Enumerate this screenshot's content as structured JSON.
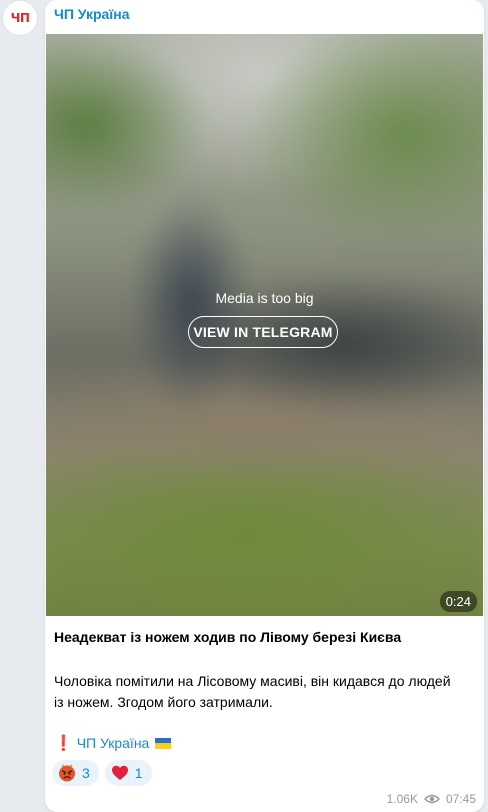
{
  "channel": {
    "name": "ЧП Україна",
    "avatar_text": "ЧП"
  },
  "media": {
    "message": "Media is too big",
    "button_label": "VIEW IN TELEGRAM",
    "duration": "0:24"
  },
  "post": {
    "title": "Неадекват із ножем ходив по Лівому березі Києва",
    "body_line1": "Чоловіка помітили на Лісовому масиві, він кидався до людей",
    "body_line2": "із ножем. Згодом його затримали.",
    "signature_mark": "❗",
    "signature": "ЧП Україна"
  },
  "reactions": [
    {
      "emoji": "angry-face-icon",
      "count": "3"
    },
    {
      "emoji": "red-heart-icon",
      "count": "1"
    }
  ],
  "meta": {
    "views": "1.06K",
    "time": "07:45"
  },
  "colors": {
    "accent": "#168acd",
    "avatar_red": "#e1262d",
    "background": "#e7ebf0"
  }
}
